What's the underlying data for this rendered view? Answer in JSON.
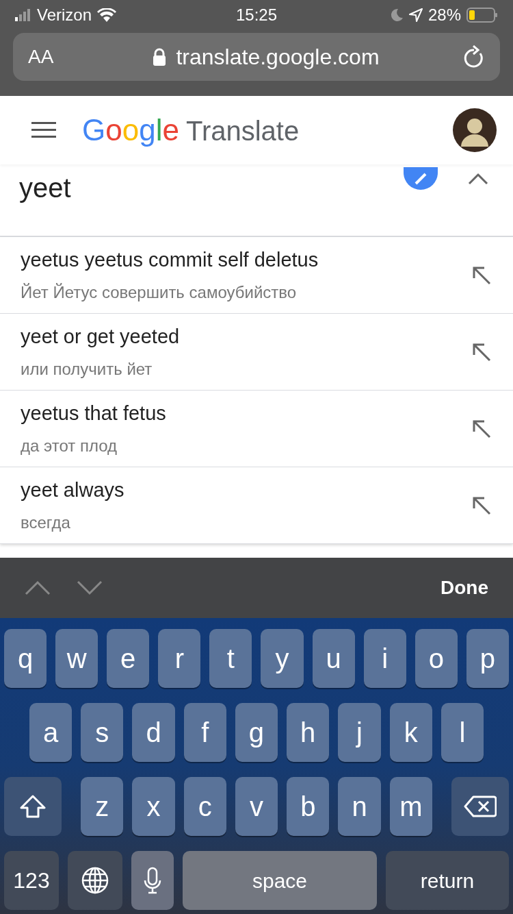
{
  "status_bar": {
    "carrier": "Verizon",
    "time": "15:25",
    "battery": "28%"
  },
  "browser": {
    "text_size": "AA",
    "url": "translate.google.com"
  },
  "header": {
    "logo": "Google",
    "title": "Translate"
  },
  "input": {
    "value": "yeet"
  },
  "suggestions": [
    {
      "text": "yeetus yeetus commit self deletus",
      "translation": "Йет Йетус совершить самоубийство"
    },
    {
      "text": "yeet or get yeeted",
      "translation": "или получить йет"
    },
    {
      "text": "yeetus that fetus",
      "translation": "да этот плод"
    },
    {
      "text": "yeet always",
      "translation": "всегда"
    }
  ],
  "keyboard_toolbar": {
    "done": "Done"
  },
  "keyboard": {
    "rows": [
      [
        "q",
        "w",
        "e",
        "r",
        "t",
        "y",
        "u",
        "i",
        "o",
        "p"
      ],
      [
        "a",
        "s",
        "d",
        "f",
        "g",
        "h",
        "j",
        "k",
        "l"
      ],
      [
        "z",
        "x",
        "c",
        "v",
        "b",
        "n",
        "m"
      ]
    ],
    "numbers": "123",
    "space": "space",
    "return": "return"
  }
}
